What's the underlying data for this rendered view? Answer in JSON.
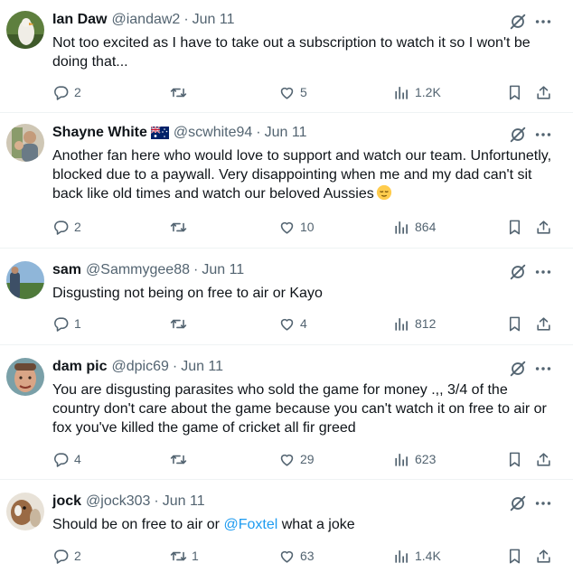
{
  "tweets": [
    {
      "name": "Ian Daw",
      "handle": "@iandaw2",
      "separator": "·",
      "date": "Jun 11",
      "text": "Not too excited as I have to take out a subscription to watch it so I won't be doing that...",
      "replies": "2",
      "retweets": "",
      "likes": "5",
      "views": "1.2K"
    },
    {
      "name": "Shayne White",
      "flag": "australia-flag",
      "handle": "@scwhite94",
      "separator": "·",
      "date": "Jun 11",
      "text": "Another fan here who would love to support and watch our team. Unfortunetly, blocked due to a paywall. Very disappointing when me and my dad can't sit back like old times and watch our beloved Aussies",
      "emoji": "relieved-face",
      "replies": "2",
      "retweets": "",
      "likes": "10",
      "views": "864"
    },
    {
      "name": "sam",
      "handle": "@Sammygee88",
      "separator": "·",
      "date": "Jun 11",
      "text": "Disgusting not being on free to air or Kayo",
      "replies": "1",
      "retweets": "",
      "likes": "4",
      "views": "812"
    },
    {
      "name": "dam pic",
      "handle": "@dpic69",
      "separator": "·",
      "date": "Jun 11",
      "text": "You are disgusting parasites who sold the game for money .,, 3/4 of the country don't care about the game because you can't watch it on free to air or fox you've killed the game of cricket all fir greed",
      "replies": "4",
      "retweets": "",
      "likes": "29",
      "views": "623"
    },
    {
      "name": "jock",
      "handle": "@jock303",
      "separator": "·",
      "date": "Jun 11",
      "text_before": "Should be on free to air or ",
      "mention": "@Foxtel",
      "text_after": " what a joke",
      "replies": "2",
      "retweets": "1",
      "likes": "63",
      "views": "1.4K"
    }
  ],
  "colors": {
    "text": "#0f1419",
    "secondary": "#536471",
    "link": "#1d9bf0",
    "divider": "#eff3f4"
  },
  "icons": [
    "reply-icon",
    "retweet-icon",
    "like-icon",
    "views-icon",
    "bookmark-icon",
    "share-icon",
    "grok-icon",
    "more-icon"
  ]
}
